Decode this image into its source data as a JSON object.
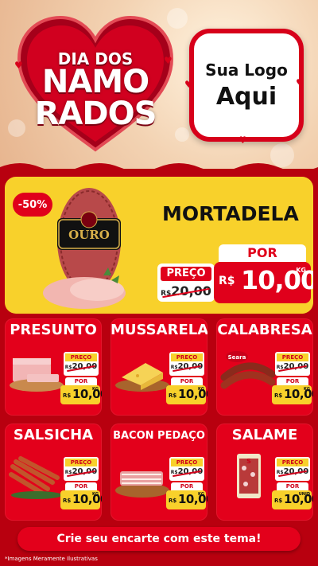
{
  "header": {
    "title_line1": "DIA DOS",
    "title_line2": "NAMO",
    "title_line3": "RADOS",
    "logo_line1": "Sua Logo",
    "logo_line2": "Aqui"
  },
  "featured": {
    "discount": "-50%",
    "name": "MORTADELA",
    "brand": "OURO",
    "price_label": "PREÇO",
    "old_currency": "R$",
    "old_price": "20,00",
    "por_label": "POR",
    "currency": "R$",
    "price": "10,00",
    "unit": "KG"
  },
  "products": [
    {
      "name": "PRESUNTO",
      "preco_label": "PREÇO",
      "old_currency": "R$",
      "old_price": "20,00",
      "por_label": "POR",
      "currency": "R$",
      "price": "10,00",
      "unit": "KG"
    },
    {
      "name": "MUSSARELA",
      "preco_label": "PREÇO",
      "old_currency": "R$",
      "old_price": "20,00",
      "por_label": "POR",
      "currency": "R$",
      "price": "10,00",
      "unit": "KG"
    },
    {
      "name": "CALABRESA",
      "brand": "Seara",
      "preco_label": "PREÇO",
      "old_currency": "R$",
      "old_price": "20,00",
      "por_label": "POR",
      "currency": "R$",
      "price": "10,00",
      "unit": "KG"
    },
    {
      "name": "SALSICHA",
      "preco_label": "PREÇO",
      "old_currency": "R$",
      "old_price": "20,00",
      "por_label": "POR",
      "currency": "R$",
      "price": "10,00",
      "unit": "KG"
    },
    {
      "name": "BACON PEDAÇO",
      "preco_label": "PREÇO",
      "old_currency": "R$",
      "old_price": "20,00",
      "por_label": "POR",
      "currency": "R$",
      "price": "10,00",
      "unit": "KG"
    },
    {
      "name": "SALAME",
      "brand": "S",
      "preco_label": "PREÇO",
      "old_currency": "R$",
      "old_price": "20,00",
      "por_label": "POR",
      "currency": "R$",
      "price": "10,00",
      "unit": "UNID"
    }
  ],
  "cta": "Crie seu encarte com este tema!",
  "footnote": "*Imagens Meramente Ilustrativas",
  "colors": {
    "red": "#e3001b",
    "dark_red": "#b8000f",
    "yellow": "#f8d12b"
  }
}
